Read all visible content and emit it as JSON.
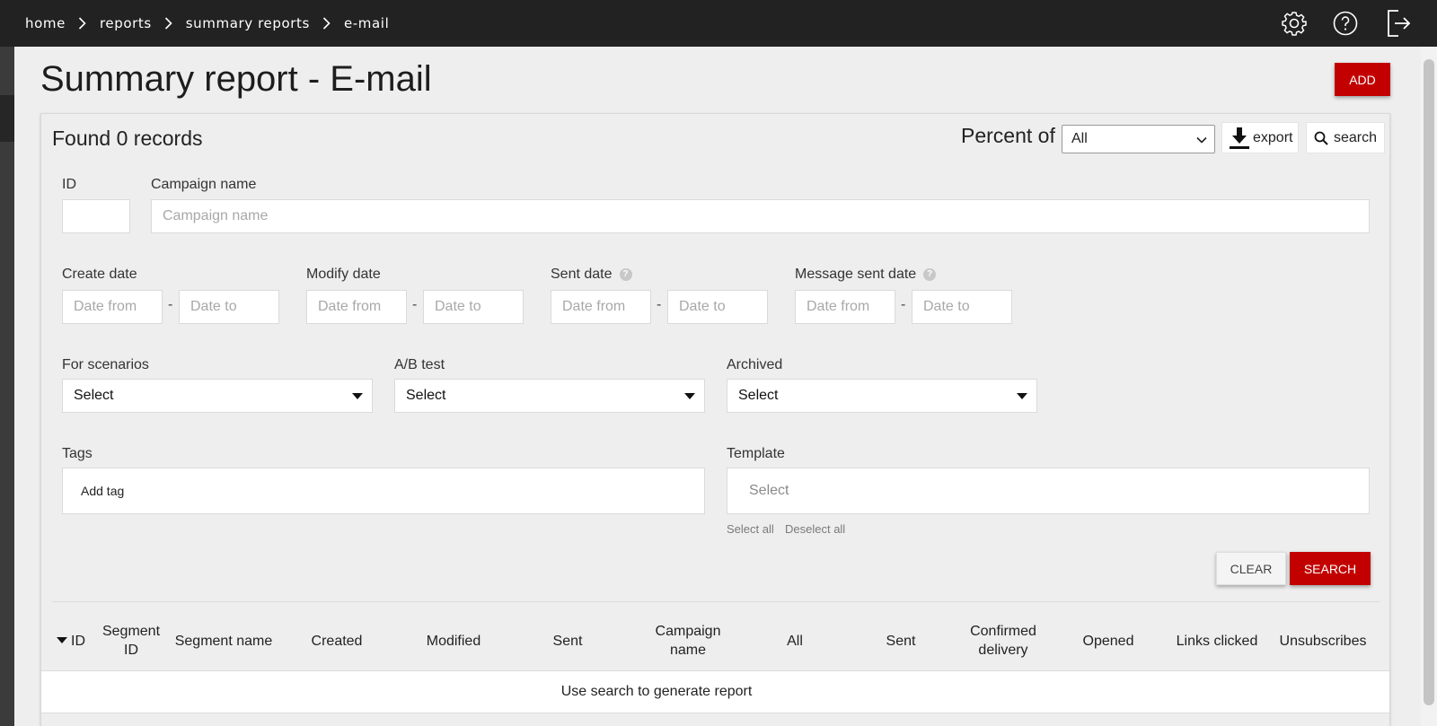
{
  "breadcrumb": [
    "home",
    "reports",
    "summary reports",
    "e-mail"
  ],
  "header": {
    "title": "Summary report - E-mail",
    "add_label": "ADD"
  },
  "toolbar": {
    "found_text": "Found 0 records",
    "percent_label": "Percent of",
    "percent_value": "All",
    "export_label": "export",
    "search_label": "search"
  },
  "filters": {
    "id_label": "ID",
    "campaign_label": "Campaign name",
    "campaign_placeholder": "Campaign name",
    "create_date_label": "Create date",
    "modify_date_label": "Modify date",
    "sent_date_label": "Sent date",
    "message_sent_date_label": "Message sent date",
    "date_from_placeholder": "Date from",
    "date_to_placeholder": "Date to",
    "dash": "-",
    "help_glyph": "?",
    "for_scenarios_label": "For scenarios",
    "ab_test_label": "A/B test",
    "archived_label": "Archived",
    "select_value": "Select",
    "tags_label": "Tags",
    "tags_value": "Add tag",
    "template_label": "Template",
    "template_placeholder": "Select",
    "select_all": "Select all",
    "deselect_all": "Deselect all",
    "clear_label": "CLEAR",
    "search_label": "SEARCH"
  },
  "table": {
    "columns": [
      "ID",
      "Segment ID",
      "Segment name",
      "Created",
      "Modified",
      "Sent",
      "Campaign name",
      "All",
      "Sent",
      "Confirmed delivery",
      "Opened",
      "Links clicked",
      "Unsubscribes"
    ],
    "empty_message": "Use search to generate report"
  },
  "icons": [
    "chevron-right-icon",
    "gear-icon",
    "help-circle-icon",
    "logout-icon",
    "download-icon",
    "search-icon",
    "chevron-down-icon",
    "sort-desc-icon"
  ],
  "colors": {
    "accent": "#c20000",
    "topbar": "#222222"
  }
}
